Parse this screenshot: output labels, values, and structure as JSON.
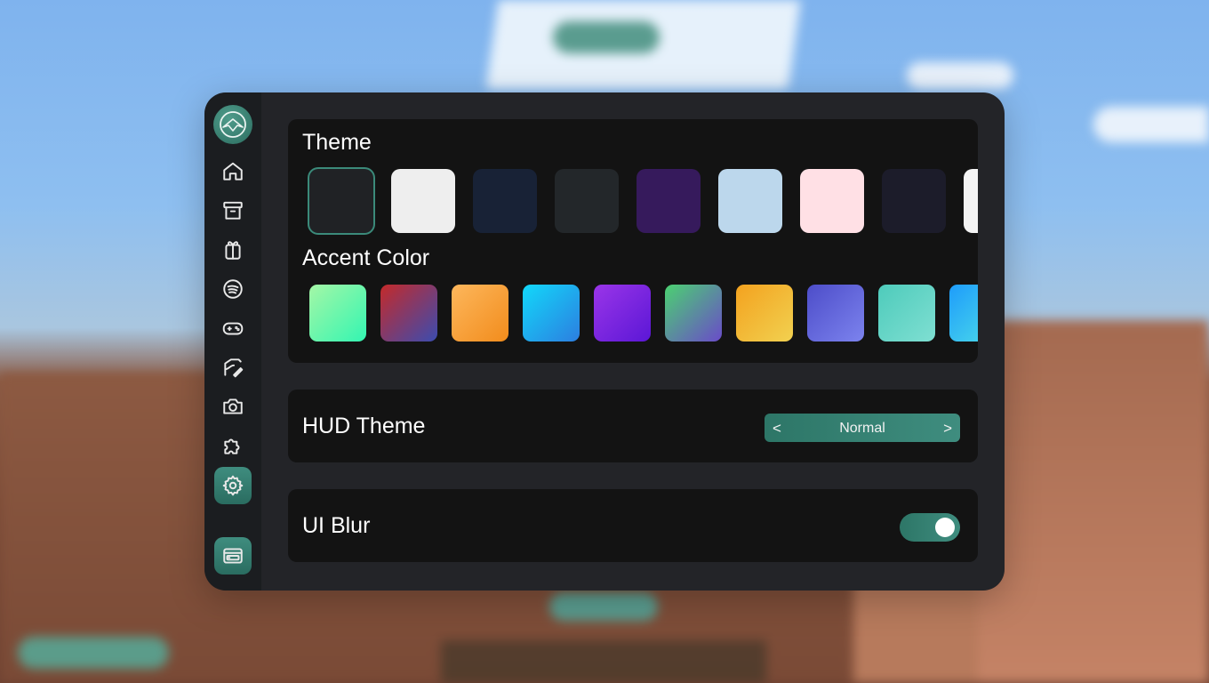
{
  "theme": {
    "title": "Theme",
    "swatches": [
      "#202225",
      "#eeeeee",
      "#182236",
      "#23272a",
      "#361a5c",
      "#bcd7ec",
      "#ffe0e5",
      "#1c1c2a",
      "#f4f4f4"
    ],
    "selected_index": 0
  },
  "accent": {
    "title": "Accent Color",
    "gradients": [
      [
        "#a4f7a6",
        "#33f5b2"
      ],
      [
        "#c42a2a",
        "#3b4cb0"
      ],
      [
        "#fdb75c",
        "#f28c1c"
      ],
      [
        "#12d8fa",
        "#2c7ee0"
      ],
      [
        "#9a35e8",
        "#5b17d6"
      ],
      [
        "#4bd171",
        "#6a4bc9"
      ],
      [
        "#f3a21f",
        "#f2d150"
      ],
      [
        "#4d4dc9",
        "#7c83ee"
      ],
      [
        "#4ecbbb",
        "#7fdfd2"
      ],
      [
        "#1e9cfb",
        "#4fe0e8"
      ]
    ]
  },
  "hud": {
    "label": "HUD Theme",
    "prev": "<",
    "next": ">",
    "value": "Normal"
  },
  "blur": {
    "label": "UI Blur",
    "enabled": true
  },
  "sidebar": {
    "items": [
      "home-icon",
      "archive-icon",
      "gift-icon",
      "spotify-icon",
      "gamepad-icon",
      "edit-icon",
      "camera-icon",
      "puzzle-icon",
      "gear-icon"
    ],
    "active": "gear-icon",
    "bottom": "hud-editor-icon"
  },
  "colors": {
    "accent": "#3f8d7f",
    "panel": "#232428",
    "card": "#131313"
  }
}
